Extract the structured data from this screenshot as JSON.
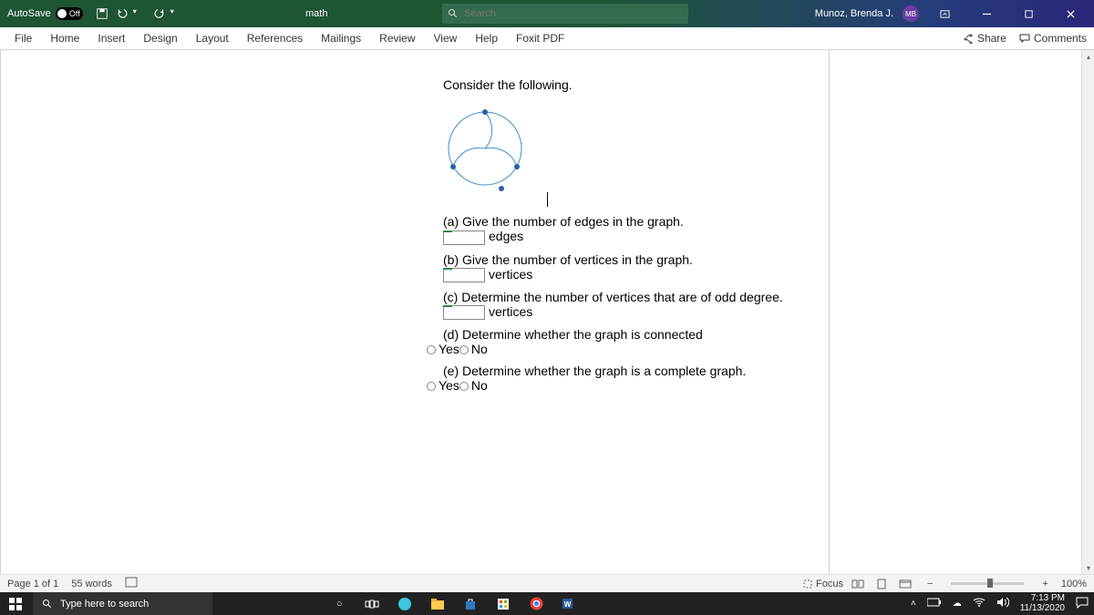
{
  "titlebar": {
    "autosave_label": "AutoSave",
    "autosave_state": "Off",
    "doc_title": "math",
    "search_placeholder": "Search",
    "user_name": "Munoz, Brenda J.",
    "user_initials": "MB"
  },
  "ribbon": {
    "tabs": [
      "File",
      "Home",
      "Insert",
      "Design",
      "Layout",
      "References",
      "Mailings",
      "Review",
      "View",
      "Help",
      "Foxit PDF"
    ],
    "share": "Share",
    "comments": "Comments"
  },
  "document": {
    "intro": "Consider the following.",
    "qa": "(a) Give the number of edges in the graph.",
    "qa_unit": "edges",
    "qb": "(b) Give the number of vertices in the graph.",
    "qb_unit": "vertices",
    "qc": "(c) Determine the number of vertices that are of odd degree.",
    "qc_unit": "vertices",
    "qd": "(d) Determine whether the graph is connected",
    "qe": "(e) Determine whether the graph is a complete graph.",
    "yes": "Yes",
    "no": "No"
  },
  "statusbar": {
    "page": "Page 1 of 1",
    "words": "55 words",
    "focus": "Focus",
    "zoom": "100%"
  },
  "taskbar": {
    "search_placeholder": "Type here to search",
    "time": "7:13 PM",
    "date": "11/13/2020"
  }
}
